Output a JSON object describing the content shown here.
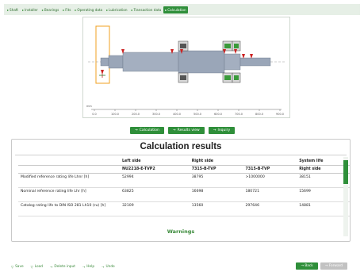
{
  "tabs": [
    {
      "label": "Shaft",
      "active": false
    },
    {
      "label": "Installer",
      "active": false
    },
    {
      "label": "Bearings",
      "active": false
    },
    {
      "label": "Fits",
      "active": false
    },
    {
      "label": "Operating data",
      "active": false
    },
    {
      "label": "Lubrication",
      "active": false
    },
    {
      "label": "Transaction data",
      "active": false
    },
    {
      "label": "Calculation",
      "active": true
    }
  ],
  "diagram": {
    "axis_ticks": [
      "0.0",
      "100.0",
      "200.0",
      "300.0",
      "400.0",
      "500.0",
      "600.0",
      "700.0",
      "800.0",
      "900.0"
    ],
    "axis_unit": "mm"
  },
  "actions": {
    "calculation": "Calculation",
    "results_view": "Results view",
    "inquiry": "Inquiry"
  },
  "results": {
    "title": "Calculation results",
    "group_headers": [
      "",
      "Left side",
      "Right side",
      "",
      "System life"
    ],
    "sub_headers": [
      "",
      "NU2218-E-TVP2",
      "7315-B-TVP",
      "7315-B-TVP",
      "Right side"
    ],
    "rows": [
      {
        "label": "Modified reference rating life Lhnr [h]",
        "values": [
          "52994",
          "38795",
          ">1000000",
          "38151"
        ]
      },
      {
        "label": "Nominal reference rating life Lhr [h]",
        "values": [
          "63825",
          "16698",
          "180721",
          "15699"
        ]
      },
      {
        "label": "Catalog rating life to DIN ISO 281 Lh10 (ru) [h]",
        "values": [
          "32109",
          "13560",
          "297646",
          "14881"
        ]
      }
    ],
    "warnings": "Warnings"
  },
  "bottom": {
    "save": "Save",
    "load": "Load",
    "delete_input": "Delete input",
    "help": "Help",
    "undo": "Undo",
    "back": "Back",
    "forward": "Forward"
  },
  "colors": {
    "accent": "#2f8f3a",
    "shaft": "#9aa6b8",
    "load_arrows": "#cc2222",
    "highlight_box": "#f0a020"
  }
}
